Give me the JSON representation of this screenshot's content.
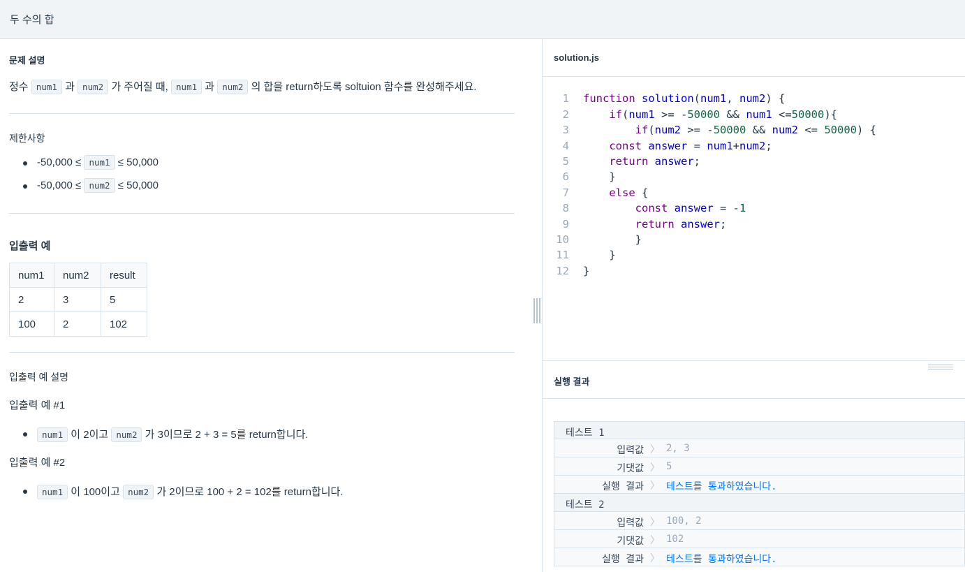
{
  "header": {
    "title": "두 수의 합"
  },
  "problem": {
    "section_title": "문제 설명",
    "desc": {
      "t1": "정수",
      "c1": "num1",
      "t2": "과",
      "c2": "num2",
      "t3": "가 주어질 때,",
      "c3": "num1",
      "t4": "과",
      "c4": "num2",
      "t5": "의 합을 return하도록 soltuion 함수를 완성해주세요."
    },
    "constraints_title": "제한사항",
    "constraints": [
      {
        "pre": "-50,000 ≤",
        "code": "num1",
        "post": "≤ 50,000"
      },
      {
        "pre": "-50,000 ≤",
        "code": "num2",
        "post": "≤ 50,000"
      }
    ],
    "io_title": "입출력 예",
    "io_table": {
      "headers": [
        "num1",
        "num2",
        "result"
      ],
      "rows": [
        [
          "2",
          "3",
          "5"
        ],
        [
          "100",
          "2",
          "102"
        ]
      ]
    },
    "io_desc_title": "입출력 예 설명",
    "examples": [
      {
        "title": "입출력 예 #1",
        "c1": "num1",
        "t1": "이 2이고",
        "c2": "num2",
        "t2": "가 3이므로 2 + 3 = 5를 return합니다."
      },
      {
        "title": "입출력 예 #2",
        "c1": "num1",
        "t1": "이 100이고",
        "c2": "num2",
        "t2": "가 2이므로 100 + 2 = 102를 return합니다."
      }
    ]
  },
  "editor": {
    "filename": "solution.js",
    "line_numbers": [
      "1",
      "2",
      "3",
      "4",
      "5",
      "6",
      "7",
      "8",
      "9",
      "10",
      "11",
      "12"
    ]
  },
  "results": {
    "title": "실행 결과",
    "tests": [
      {
        "name": "테스트 1",
        "input_label": "입력값",
        "input": "2, 3",
        "expected_label": "기댓값",
        "expected": "5",
        "result_label": "실행 결과",
        "result": "테스트를 통과하였습니다."
      },
      {
        "name": "테스트 2",
        "input_label": "입력값",
        "input": "100, 2",
        "expected_label": "기댓값",
        "expected": "102",
        "result_label": "실행 결과",
        "result": "테스트를 통과하였습니다."
      }
    ],
    "arrow": "〉"
  }
}
